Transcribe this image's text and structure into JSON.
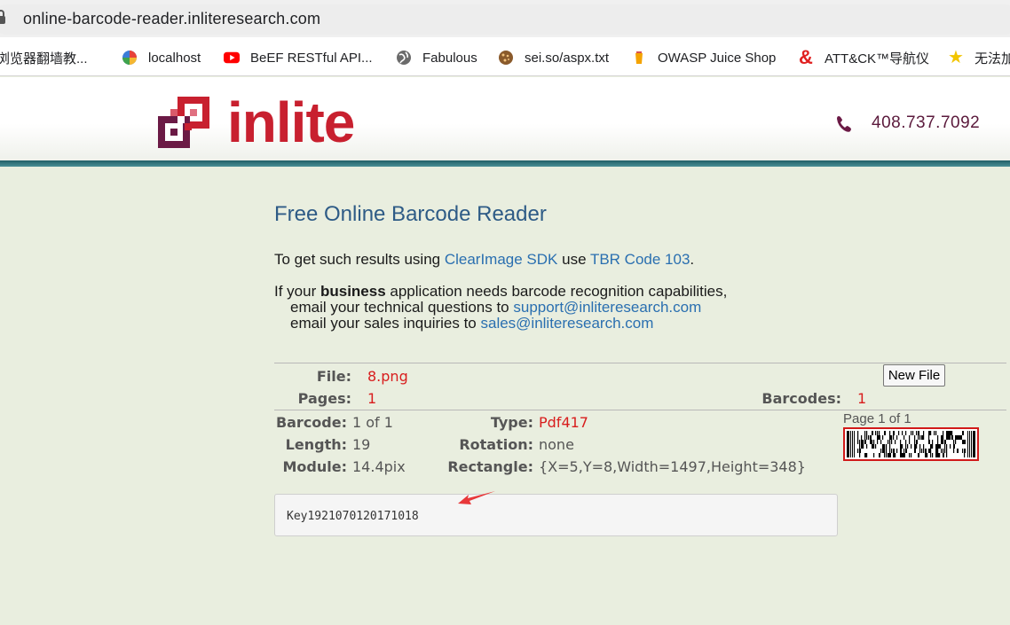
{
  "browser": {
    "url": "online-barcode-reader.inliteresearch.com",
    "bookmarks": [
      {
        "label": "浏览器翻墙教...",
        "icon": "bookmark-icon"
      },
      {
        "label": "localhost",
        "icon": "colorful-circle-icon"
      },
      {
        "label": "BeEF RESTful API...",
        "icon": "youtube-icon"
      },
      {
        "label": "Fabulous",
        "icon": "globe-icon"
      },
      {
        "label": "sei.so/aspx.txt",
        "icon": "cookie-icon"
      },
      {
        "label": "OWASP Juice Shop",
        "icon": "juice-icon"
      },
      {
        "label": "ATT&CK™导航仪",
        "icon": "ampersand-icon"
      },
      {
        "label": "无法加",
        "icon": "star-icon"
      }
    ]
  },
  "site": {
    "logo_text": "inlite",
    "phone": "408.737.7092"
  },
  "main": {
    "title": "Free Online Barcode Reader",
    "intro_prefix": "To get such results using ",
    "sdk_link": "ClearImage SDK",
    "intro_mid": " use ",
    "code_link": "TBR Code 103",
    "intro_suffix": ".",
    "business_prefix": "If your ",
    "business_bold": "business",
    "business_suffix": " application needs barcode recognition capabilities,",
    "tech_prefix": "email your technical questions to ",
    "tech_email": "support@inliteresearch.com",
    "sales_prefix": "email your sales inquiries to ",
    "sales_email": "sales@inliteresearch.com"
  },
  "file_info": {
    "file_label": "File:",
    "file_value": "8.png",
    "pages_label": "Pages:",
    "pages_value": "1",
    "barcodes_label": "Barcodes:",
    "barcodes_value": "1",
    "new_file_button": "New File"
  },
  "barcode": {
    "barcode_label": "Barcode:",
    "barcode_value": "1 of 1",
    "type_label": "Type:",
    "type_value": "Pdf417",
    "length_label": "Length:",
    "length_value": "19",
    "rotation_label": "Rotation:",
    "rotation_value": "none",
    "module_label": "Module:",
    "module_value": "14.4pix",
    "rectangle_label": "Rectangle:",
    "rectangle_value": "{X=5,Y=8,Width=1497,Height=348}",
    "page_label": "Page 1 of 1",
    "decoded_text": "Key1921070120171018"
  },
  "colors": {
    "background": "#e9eedf",
    "title_blue": "#2e5b86",
    "link_blue": "#2a6fb0",
    "value_red": "#d81d1d",
    "logo_red": "#c8202f",
    "header_line": "#215f67"
  }
}
